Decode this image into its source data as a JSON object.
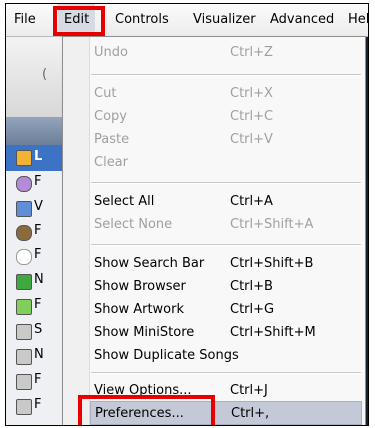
{
  "menubar": {
    "items": [
      "File",
      "Edit",
      "Controls",
      "Visualizer",
      "Advanced",
      "Hel"
    ]
  },
  "leftstrip": {
    "letters": [
      "(",
      "L",
      "F",
      "V",
      "F",
      "F",
      "N",
      "F",
      "S",
      "N",
      "F",
      "F"
    ]
  },
  "edit_menu": {
    "items": [
      {
        "label": "Undo",
        "shortcut": "Ctrl+Z"
      },
      {
        "label": "Cut",
        "shortcut": "Ctrl+X"
      },
      {
        "label": "Copy",
        "shortcut": "Ctrl+C"
      },
      {
        "label": "Paste",
        "shortcut": "Ctrl+V"
      },
      {
        "label": "Clear",
        "shortcut": ""
      },
      {
        "label": "Select All",
        "shortcut": "Ctrl+A"
      },
      {
        "label": "Select None",
        "shortcut": "Ctrl+Shift+A"
      },
      {
        "label": "Show Search Bar",
        "shortcut": "Ctrl+Shift+B"
      },
      {
        "label": "Show Browser",
        "shortcut": "Ctrl+B"
      },
      {
        "label": "Show Artwork",
        "shortcut": "Ctrl+G"
      },
      {
        "label": "Show MiniStore",
        "shortcut": "Ctrl+Shift+M"
      },
      {
        "label": "Show Duplicate Songs",
        "shortcut": ""
      },
      {
        "label": "View Options...",
        "shortcut": "Ctrl+J"
      },
      {
        "label": "Preferences...",
        "shortcut": "Ctrl+,"
      }
    ]
  },
  "colors": {
    "highlight_box": "#e60000",
    "selected_item": "#c3c9d6",
    "disabled_text": "#a0a0a0"
  }
}
